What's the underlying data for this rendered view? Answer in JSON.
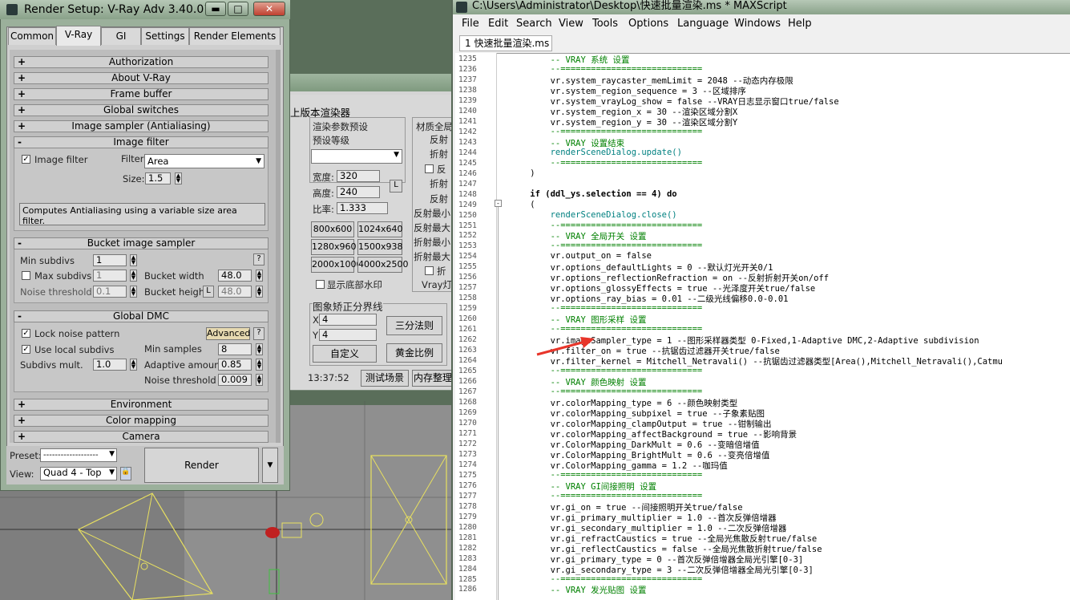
{
  "render_setup": {
    "title": "Render Setup: V-Ray Adv 3.40.01",
    "tabs": [
      "Common",
      "V-Ray",
      "GI",
      "Settings",
      "Render Elements"
    ],
    "rollouts_top": [
      "Authorization",
      "About V-Ray",
      "Frame buffer",
      "Global switches",
      "Image sampler (Antialiasing)"
    ],
    "image_filter": {
      "header": "Image filter",
      "checkbox_label": "Image filter",
      "filter_label": "Filter",
      "filter_value": "Area",
      "size_label": "Size:",
      "size_value": "1.5",
      "description": "Computes Antialiasing using a variable size area filter."
    },
    "bucket": {
      "header": "Bucket image sampler",
      "min_subdivs_label": "Min subdivs",
      "min_subdivs_value": "1",
      "help": "?",
      "max_subdivs_label": "Max subdivs",
      "max_subdivs_value": "1",
      "bucket_width_label": "Bucket width",
      "bucket_width_value": "48.0",
      "noise_threshold_label": "Noise threshold",
      "noise_threshold_value": "0.1",
      "bucket_height_label": "Bucket height",
      "bucket_height_lock": "L",
      "bucket_height_value": "48.0"
    },
    "dmc": {
      "header": "Global DMC",
      "lock_noise_label": "Lock noise pattern",
      "advanced_label": "Advanced",
      "help": "?",
      "use_local_label": "Use local subdivs",
      "min_samples_label": "Min samples",
      "min_samples_value": "8",
      "subdivs_mult_label": "Subdivs mult.",
      "subdivs_mult_value": "1.0",
      "adaptive_amount_label": "Adaptive amount",
      "adaptive_amount_value": "0.85",
      "noise_threshold_label": "Noise threshold",
      "noise_threshold_value": "0.009"
    },
    "rollouts_bottom": [
      "Environment",
      "Color mapping",
      "Camera"
    ],
    "preset_label": "Preset:",
    "preset_value": "-------------------",
    "view_label": "View:",
    "view_value": "Quad 4 - Top",
    "render_button": "Render"
  },
  "mid_dialog": {
    "title": "上版本渲染器",
    "preset_group": "渲染参数预设",
    "preset_level": "预设等级",
    "width_label": "宽度:",
    "width_value": "320",
    "height_label": "高度:",
    "height_value": "240",
    "ratio_label": "比率:",
    "ratio_value": "1.333",
    "lock": "L",
    "sizes": [
      "800x600",
      "1024x640",
      "1280x960",
      "1500x938",
      "2000x1000",
      "4000x2500"
    ],
    "watermark": "显示底部水印",
    "material_group": "材质全局",
    "mat_items": [
      "反射",
      "折射",
      "反",
      "折射",
      "反射",
      "反射最小",
      "反射最大",
      "折射最小",
      "折射最大",
      "折",
      "Vray灯"
    ],
    "image_split_group": "图象矫正分界线",
    "x_label": "X",
    "x_value": "4",
    "y_label": "Y",
    "y_value": "4",
    "thirds": "三分法则",
    "custom": "自定义",
    "golden": "黄金比例",
    "time": "13:37:52",
    "test_scene": "测试场景",
    "mem_clean": "内存整理"
  },
  "maxscript": {
    "title": "C:\\Users\\Administrator\\Desktop\\快速批量渲染.ms * MAXScript",
    "menus": [
      "File",
      "Edit",
      "Search",
      "View",
      "Tools",
      "Options",
      "Language",
      "Windows",
      "Help"
    ],
    "tab": "1 快速批量渲染.ms *",
    "lines": [
      {
        "n": "1235",
        "t": "        -- VRAY 系统 设置",
        "c": "cm"
      },
      {
        "n": "1236",
        "t": "        --============================",
        "c": "cm"
      },
      {
        "n": "1237",
        "t": "        vr.system_raycaster_memLimit = 2048 --动态内存极限",
        "c": ""
      },
      {
        "n": "1238",
        "t": "        vr.system_region_sequence = 3 --区域排序",
        "c": ""
      },
      {
        "n": "1239",
        "t": "        vr.system_vrayLog_show = false --VRAY日志显示窗口true/false",
        "c": ""
      },
      {
        "n": "1240",
        "t": "        vr.system_region_x = 30 --渲染区域分割X",
        "c": ""
      },
      {
        "n": "1241",
        "t": "        vr.system_region_y = 30 --渲染区域分割Y",
        "c": ""
      },
      {
        "n": "1242",
        "t": "        --============================",
        "c": "cm"
      },
      {
        "n": "1243",
        "t": "        -- VRAY 设置结束",
        "c": "cm"
      },
      {
        "n": "1244",
        "t": "        renderSceneDialog.update()",
        "c": "fn"
      },
      {
        "n": "1245",
        "t": "        --============================",
        "c": "cm"
      },
      {
        "n": "1246",
        "t": "    )",
        "c": ""
      },
      {
        "n": "1247",
        "t": "",
        "c": ""
      },
      {
        "n": "1248",
        "t": "    if (ddl_ys.selection == 4) do",
        "c": "kw"
      },
      {
        "n": "1249",
        "t": "    (",
        "c": ""
      },
      {
        "n": "1250",
        "t": "        renderSceneDialog.close()",
        "c": "fn"
      },
      {
        "n": "1251",
        "t": "        --============================",
        "c": "cm"
      },
      {
        "n": "1252",
        "t": "        -- VRAY 全局开关 设置",
        "c": "cm"
      },
      {
        "n": "1253",
        "t": "        --============================",
        "c": "cm"
      },
      {
        "n": "1254",
        "t": "        vr.output_on = false",
        "c": ""
      },
      {
        "n": "1255",
        "t": "        vr.options_defaultLights = 0 --默认灯光开关0/1",
        "c": ""
      },
      {
        "n": "1256",
        "t": "        vr.options_reflectionRefraction = on --反射折射开关on/off",
        "c": ""
      },
      {
        "n": "1257",
        "t": "        vr.options_glossyEffects = true --光泽度开关true/false",
        "c": ""
      },
      {
        "n": "1258",
        "t": "        vr.options_ray_bias = 0.01 --二级光线偏移0.0-0.01",
        "c": ""
      },
      {
        "n": "1259",
        "t": "        --============================",
        "c": "cm"
      },
      {
        "n": "1260",
        "t": "        -- VRAY 图形采样 设置",
        "c": "cm"
      },
      {
        "n": "1261",
        "t": "        --============================",
        "c": "cm"
      },
      {
        "n": "1262",
        "t": "        vr.imageSampler_type = 1 --图形采样器类型 0-Fixed,1-Adaptive DMC,2-Adaptive subdivision",
        "c": ""
      },
      {
        "n": "1263",
        "t": "        vr.filter_on = true --抗锯齿过滤器开关true/false",
        "c": ""
      },
      {
        "n": "1264",
        "t": "        vr.filter_kernel = Mitchell_Netravali() --抗锯齿过滤器类型[Area(),Mitchell_Netravali(),Catmu",
        "c": ""
      },
      {
        "n": "1265",
        "t": "        --============================",
        "c": "cm"
      },
      {
        "n": "1266",
        "t": "        -- VRAY 颜色映射 设置",
        "c": "cm"
      },
      {
        "n": "1267",
        "t": "        --============================",
        "c": "cm"
      },
      {
        "n": "1268",
        "t": "        vr.colorMapping_type = 6 --颜色映射类型",
        "c": ""
      },
      {
        "n": "1269",
        "t": "        vr.colorMapping_subpixel = true --子象素贴图",
        "c": ""
      },
      {
        "n": "1270",
        "t": "        vr.colorMapping_clampOutput = true --钳制输出",
        "c": ""
      },
      {
        "n": "1271",
        "t": "        vr.colorMapping_affectBackground = true --影响背景",
        "c": ""
      },
      {
        "n": "1272",
        "t": "        vr.ColorMapping_DarkMult = 0.6 --变暗倍增值",
        "c": ""
      },
      {
        "n": "1273",
        "t": "        vr.ColorMapping_BrightMult = 0.6 --变亮倍增值",
        "c": ""
      },
      {
        "n": "1274",
        "t": "        vr.ColorMapping_gamma = 1.2 --咖玛值",
        "c": ""
      },
      {
        "n": "1275",
        "t": "        --============================",
        "c": "cm"
      },
      {
        "n": "1276",
        "t": "        -- VRAY GI间接照明 设置",
        "c": "cm"
      },
      {
        "n": "1277",
        "t": "        --============================",
        "c": "cm"
      },
      {
        "n": "1278",
        "t": "        vr.gi_on = true --间接照明开关true/false",
        "c": ""
      },
      {
        "n": "1279",
        "t": "        vr.gi_primary_multiplier = 1.0 --首次反弹倍增器",
        "c": ""
      },
      {
        "n": "1280",
        "t": "        vr.gi_secondary_multiplier = 1.0 --二次反弹倍增器",
        "c": ""
      },
      {
        "n": "1281",
        "t": "        vr.gi_refractCaustics = true --全局光焦散反射true/false",
        "c": ""
      },
      {
        "n": "1282",
        "t": "        vr.gi_reflectCaustics = false --全局光焦散折射true/false",
        "c": ""
      },
      {
        "n": "1283",
        "t": "        vr.gi_primary_type = 0 --首次反弹倍增器全局光引擎[0-3]",
        "c": ""
      },
      {
        "n": "1284",
        "t": "        vr.gi_secondary_type = 3 --二次反弹倍增器全局光引擎[0-3]",
        "c": ""
      },
      {
        "n": "1285",
        "t": "        --============================",
        "c": "cm"
      },
      {
        "n": "1286",
        "t": "        -- VRAY 发光贴图 设置",
        "c": "cm"
      }
    ]
  },
  "colors": {
    "accent": "#e8352a",
    "comment": "#008000",
    "number": "#0000ff"
  }
}
